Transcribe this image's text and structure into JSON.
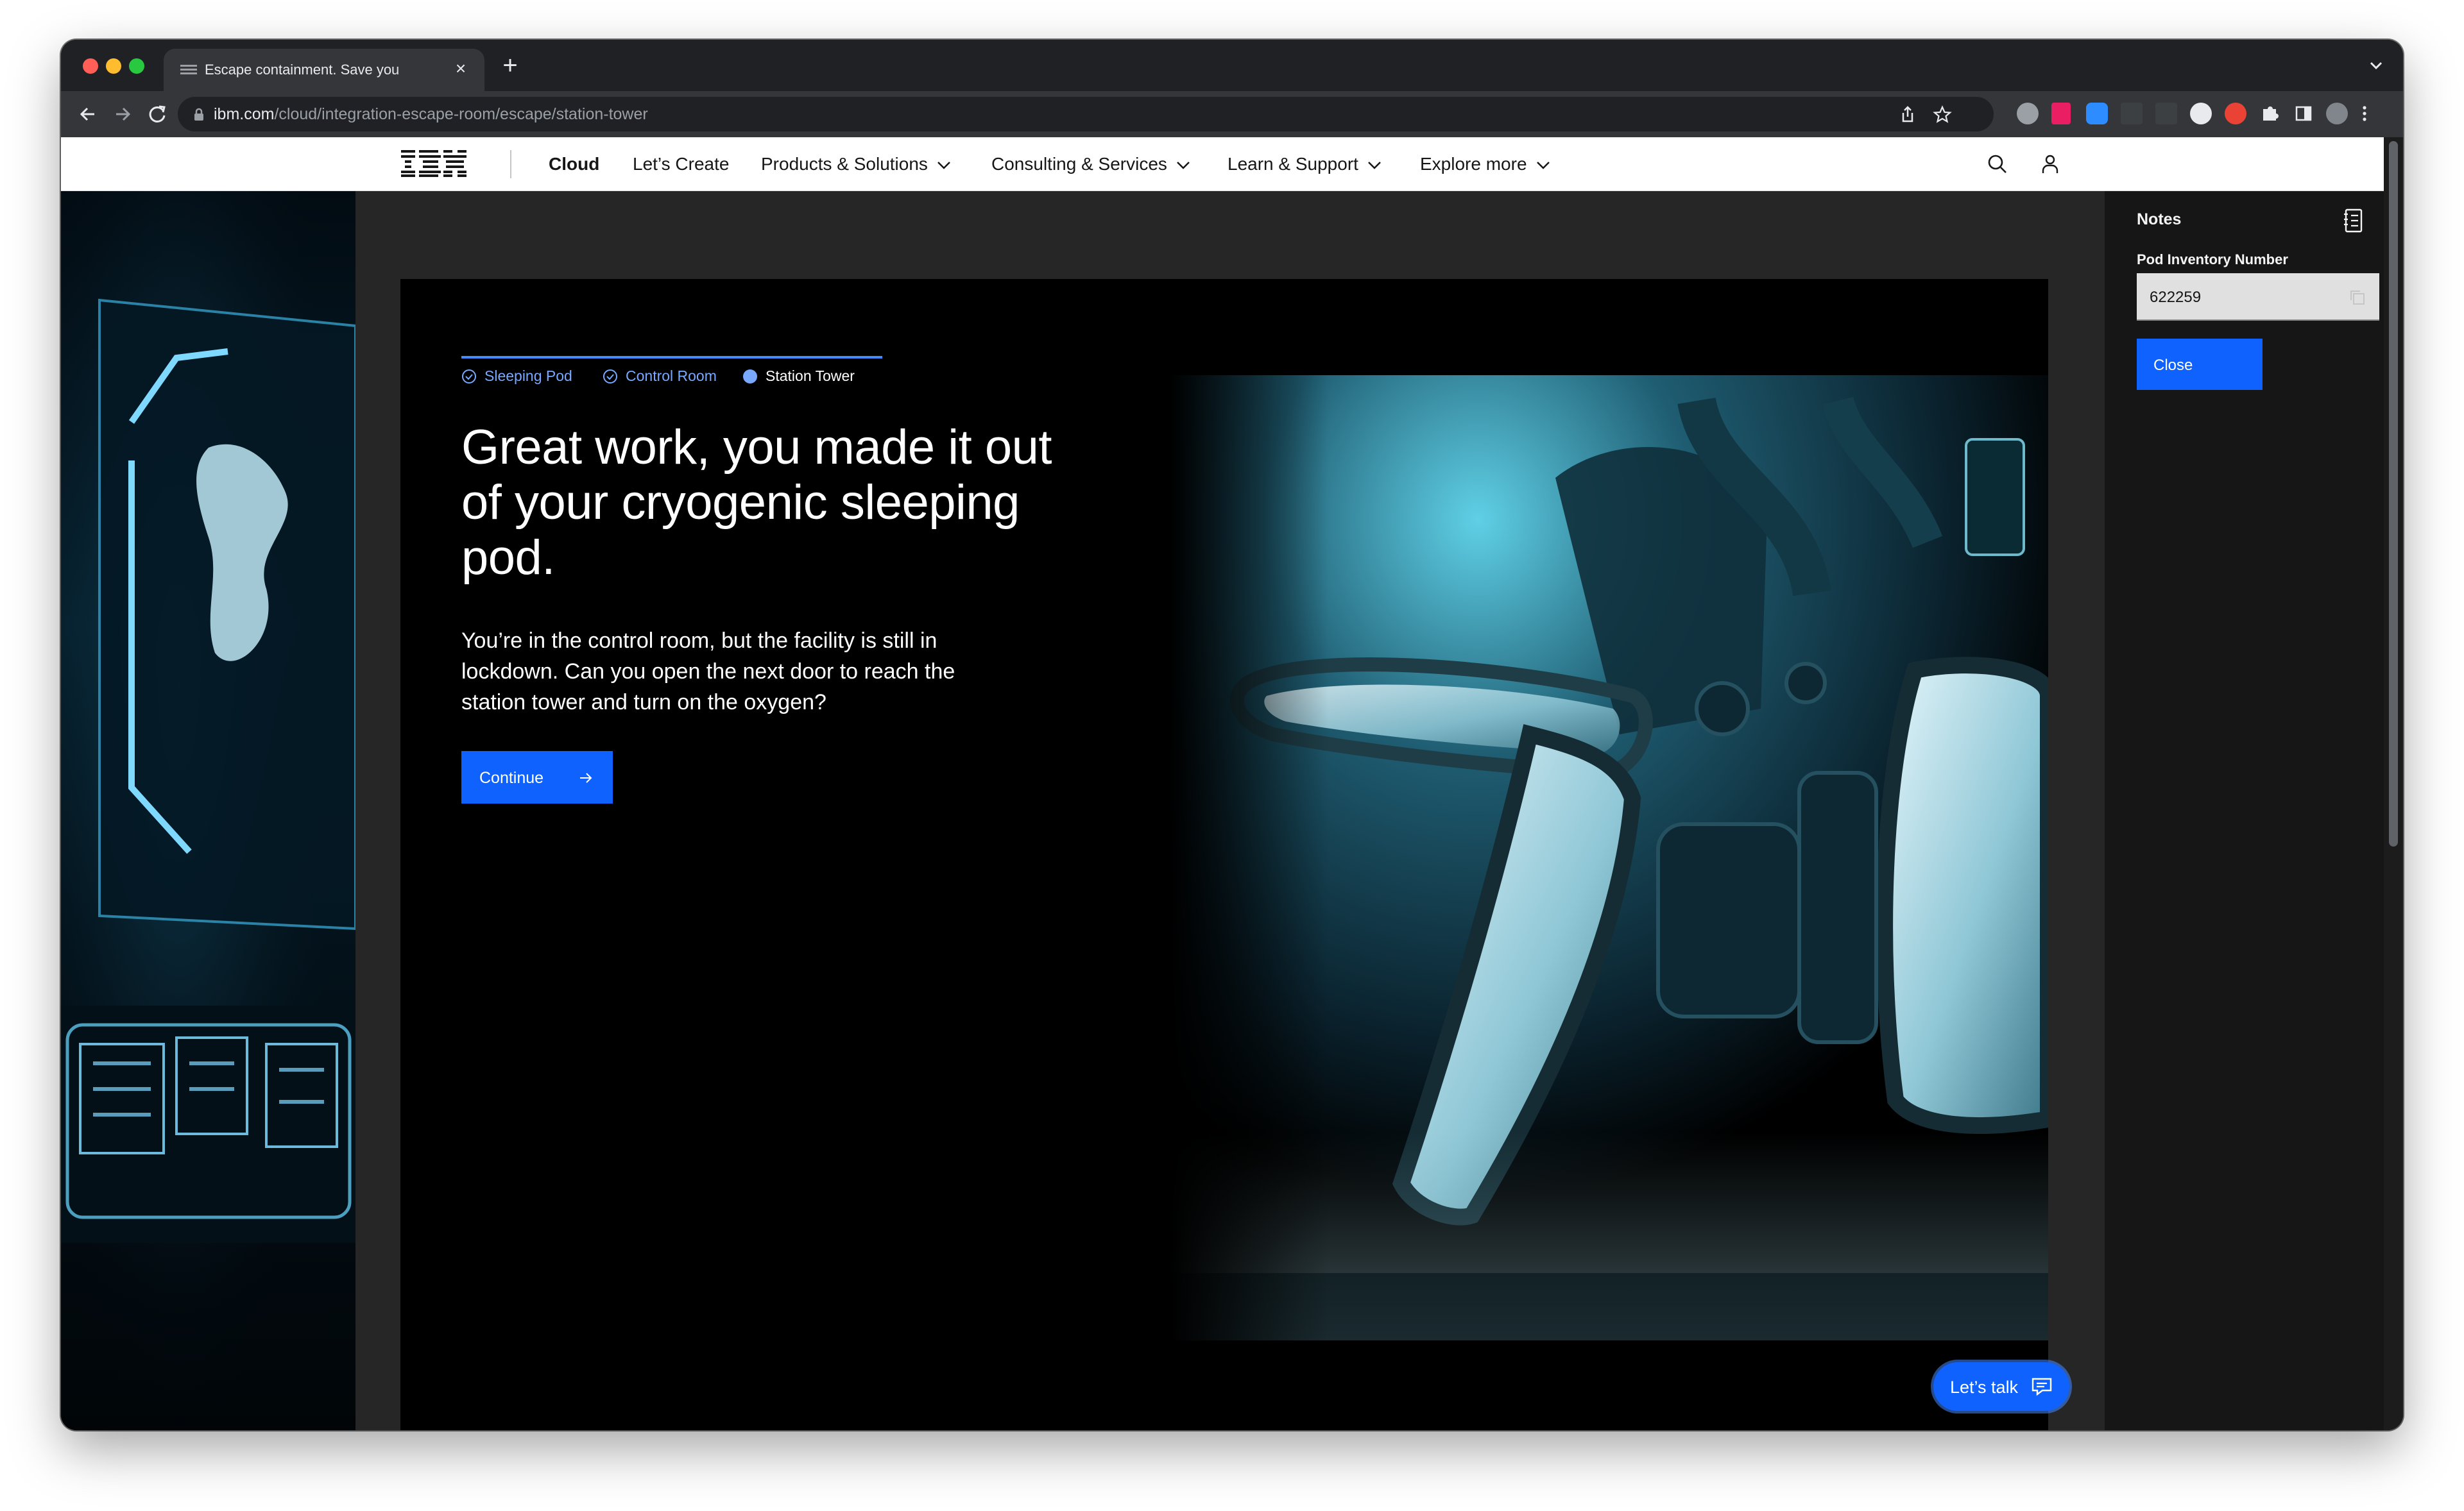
{
  "browser": {
    "tab_title": "Escape containment. Save you",
    "tab_close": "×",
    "new_tab": "+",
    "url_host": "ibm.com",
    "url_path": "/cloud/integration-escape-room/escape/station-tower"
  },
  "header": {
    "logo": "IBM",
    "nav": [
      {
        "label": "Cloud",
        "bold": true
      },
      {
        "label": "Let’s Create"
      },
      {
        "label": "Products & Solutions",
        "dropdown": true
      },
      {
        "label": "Consulting & Services",
        "dropdown": true
      },
      {
        "label": "Learn & Support",
        "dropdown": true
      },
      {
        "label": "Explore more",
        "dropdown": true
      }
    ],
    "icons": [
      "search-icon",
      "user-icon"
    ]
  },
  "progress": {
    "steps": [
      {
        "label": "Sleeping Pod",
        "state": "complete"
      },
      {
        "label": "Control Room",
        "state": "complete"
      },
      {
        "label": "Station Tower",
        "state": "current"
      }
    ]
  },
  "modal": {
    "headline": "Great work, you made it out of your cryogenic sleeping pod.",
    "body": "You’re in the control room, but the facility is still in lockdown. Can you open the next door to reach the station tower and turn on the oxygen?",
    "continue_label": "Continue"
  },
  "notes": {
    "title": "Notes",
    "field_label": "Pod Inventory Number",
    "field_value": "622259",
    "close_label": "Close"
  },
  "chat": {
    "label": "Let’s talk"
  },
  "colors": {
    "accent": "#0f62fe",
    "step_complete": "#78a9ff",
    "panel_bg": "#161616"
  }
}
